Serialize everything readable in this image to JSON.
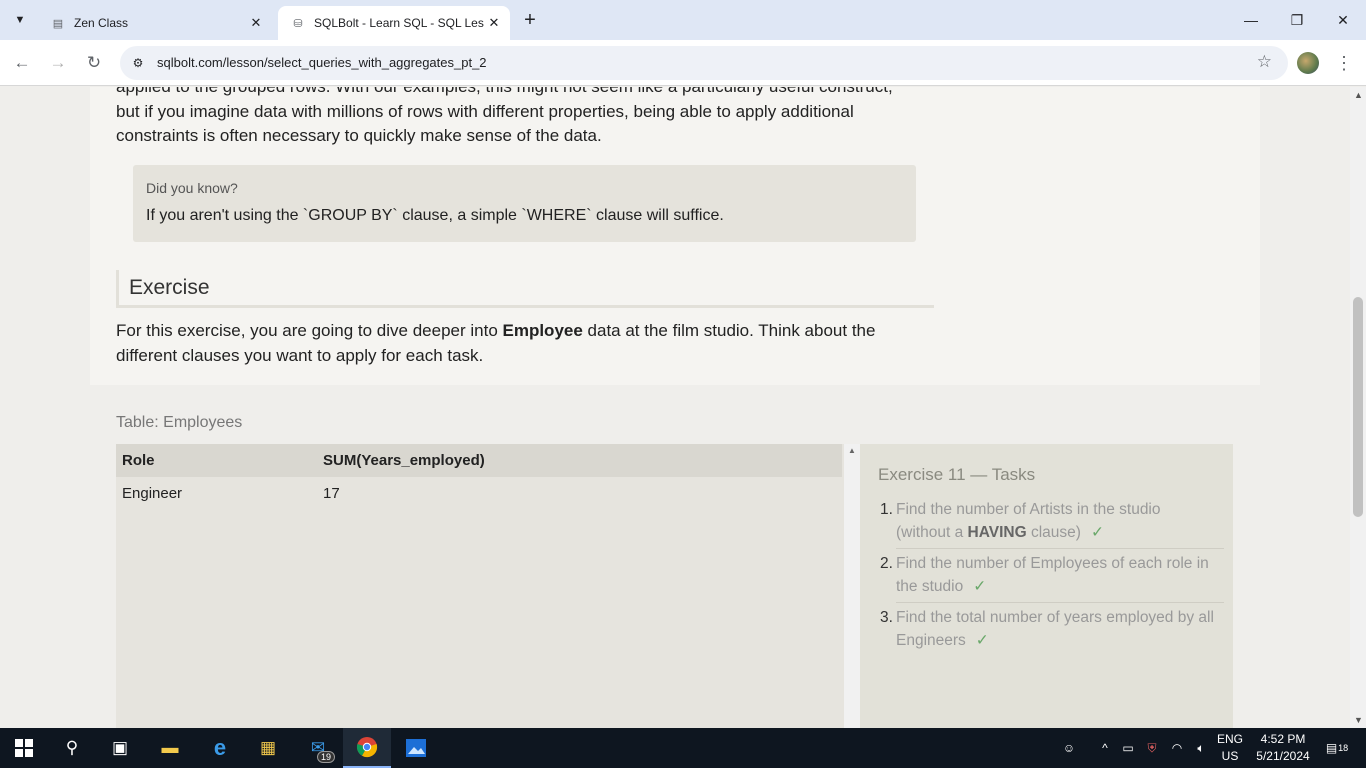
{
  "browser": {
    "tabs": [
      {
        "title": "Zen Class",
        "active": false,
        "icon": "zen-class-favicon"
      },
      {
        "title": "SQLBolt - Learn SQL - SQL Less",
        "active": true,
        "icon": "sqlbolt-favicon"
      }
    ],
    "url": "sqlbolt.com/lesson/select_queries_with_aggregates_pt_2"
  },
  "lesson": {
    "intro_lines": [
      "applied to the grouped rows. With our examples, this might not seem like a particularly useful construct,",
      "but if you imagine data with millions of rows with different properties, being able to apply additional",
      "constraints is often necessary to quickly make sense of the data."
    ],
    "did_you_know": {
      "title": "Did you know?",
      "text": "If you aren't using the `GROUP BY` clause, a simple `WHERE` clause will suffice."
    },
    "exercise_heading": "Exercise",
    "exercise_text_pre": "For this exercise, you are going to dive deeper into ",
    "exercise_text_bold": "Employee",
    "exercise_text_post": " data at the film studio. Think about the",
    "exercise_text_line2": "different clauses you want to apply for each task."
  },
  "results": {
    "table_label": "Table: Employees",
    "columns": [
      "Role",
      "SUM(Years_employed)"
    ],
    "rows": [
      [
        "Engineer",
        "17"
      ]
    ]
  },
  "tasks": {
    "title": "Exercise 11 — Tasks",
    "items": [
      {
        "num": "1.",
        "line1": "Find the number of Artists in the studio",
        "line2_pre": "(without a ",
        "line2_bold": "HAVING",
        "line2_post": " clause)",
        "check": "✓"
      },
      {
        "num": "2.",
        "line1": "Find the number of Employees of each role in",
        "line2_pre": "the studio",
        "line2_bold": "",
        "line2_post": "",
        "check": "✓"
      },
      {
        "num": "3.",
        "line1": "Find the total number of years employed by all",
        "line2_pre": "Engineers",
        "line2_bold": "",
        "line2_post": "",
        "check": "✓"
      }
    ]
  },
  "taskbar": {
    "mail_badge": "19",
    "language": [
      "ENG",
      "US"
    ],
    "time": "4:52 PM",
    "date": "5/21/2024",
    "notifications": "18"
  }
}
